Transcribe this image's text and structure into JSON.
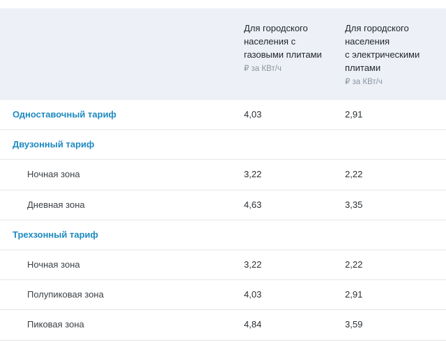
{
  "header": {
    "col_gas_title": "Для городского\nнаселения с\nгазовыми плитами",
    "col_gas_unit": "₽ за КВт/ч",
    "col_el_title": "Для городского\nнаселения\nс электрическими\nплитами",
    "col_el_unit": "₽ за КВт/ч"
  },
  "rows": [
    {
      "label": "Одноставочный тариф",
      "gas": "4,03",
      "el": "2,91"
    },
    {
      "label": "Двузонный тариф",
      "gas": "",
      "el": ""
    },
    {
      "label": "Ночная зона",
      "gas": "3,22",
      "el": "2,22"
    },
    {
      "label": "Дневная зона",
      "gas": "4,63",
      "el": "3,35"
    },
    {
      "label": "Трехзонный тариф",
      "gas": "",
      "el": ""
    },
    {
      "label": "Ночная зона",
      "gas": "3,22",
      "el": "2,22"
    },
    {
      "label": "Полупиковая зона",
      "gas": "4,03",
      "el": "2,91"
    },
    {
      "label": "Пиковая зона",
      "gas": "4,84",
      "el": "3,59"
    }
  ],
  "colors": {
    "header_bg": "#edf1f7",
    "group_label": "#1e8ac0",
    "divider": "#e3e7ec"
  }
}
